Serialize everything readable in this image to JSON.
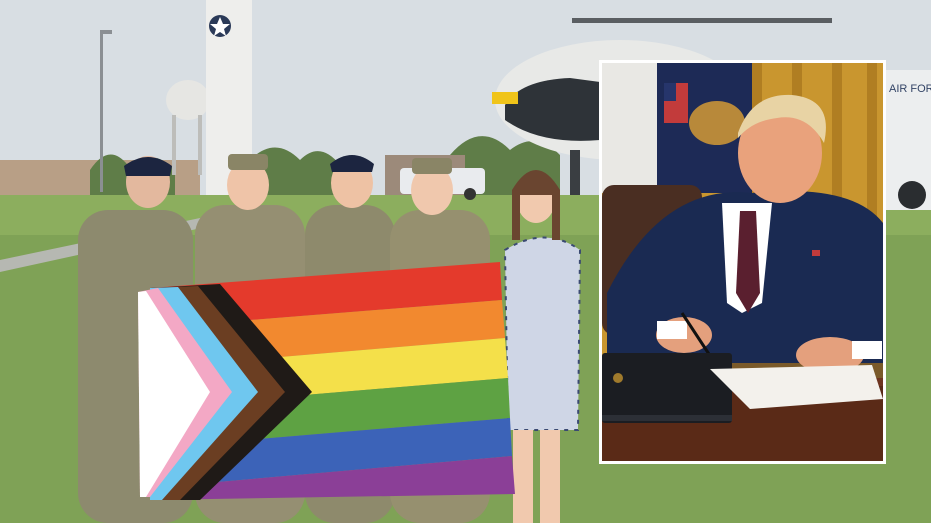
{
  "image": {
    "main_photo": "airmen-with-progress-pride-flag",
    "inset_photo": "president-signing-document"
  },
  "scene_text": {
    "trailer_text": "AIR FOR"
  },
  "colors": {
    "sky": "#d6dde3",
    "grass": "#7fa256",
    "inset_border": "#ffffff",
    "flag_red": "#e43a2c",
    "flag_orange": "#f2892f",
    "flag_yellow": "#f4e04a",
    "flag_green": "#5ea243",
    "flag_blue": "#3c63b8",
    "flag_purple": "#8b3f97",
    "curtain_gold": "#c9962f"
  }
}
